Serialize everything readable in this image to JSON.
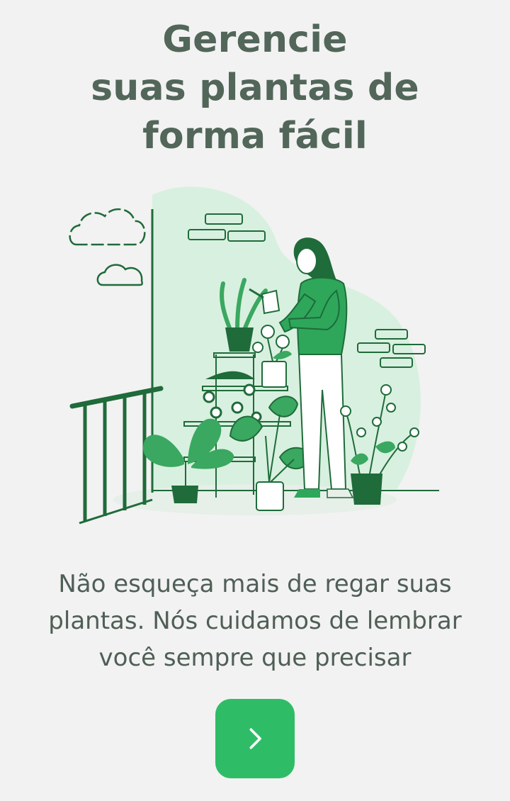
{
  "onboarding": {
    "title_lines": [
      "Gerencie",
      "suas plantas de",
      "forma fácil"
    ],
    "description_lines": [
      "Não esqueça mais de regar suas",
      "plantas. Nós cuidamos de lembrar",
      "você sempre que precisar"
    ],
    "next_button_icon": "chevron-right-icon"
  },
  "colors": {
    "background": "#f2f2f2",
    "title": "#52665a",
    "text": "#4f5f56",
    "accent": "#2ebd66",
    "illustration_dark": "#1f6b3a",
    "illustration_light": "#d8f0df"
  }
}
